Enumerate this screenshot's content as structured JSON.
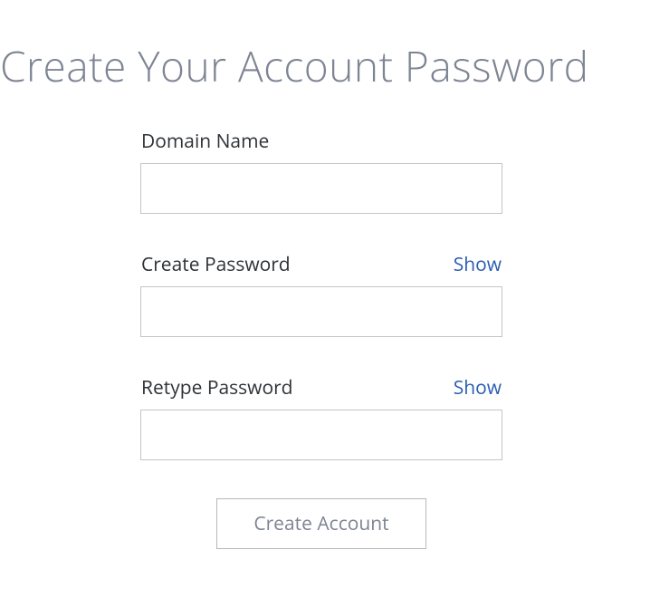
{
  "title": "Create Your Account Password",
  "fields": {
    "domain": {
      "label": "Domain Name",
      "value": ""
    },
    "password": {
      "label": "Create Password",
      "show_label": "Show",
      "value": ""
    },
    "retype": {
      "label": "Retype Password",
      "show_label": "Show",
      "value": ""
    }
  },
  "submit_label": "Create Account"
}
